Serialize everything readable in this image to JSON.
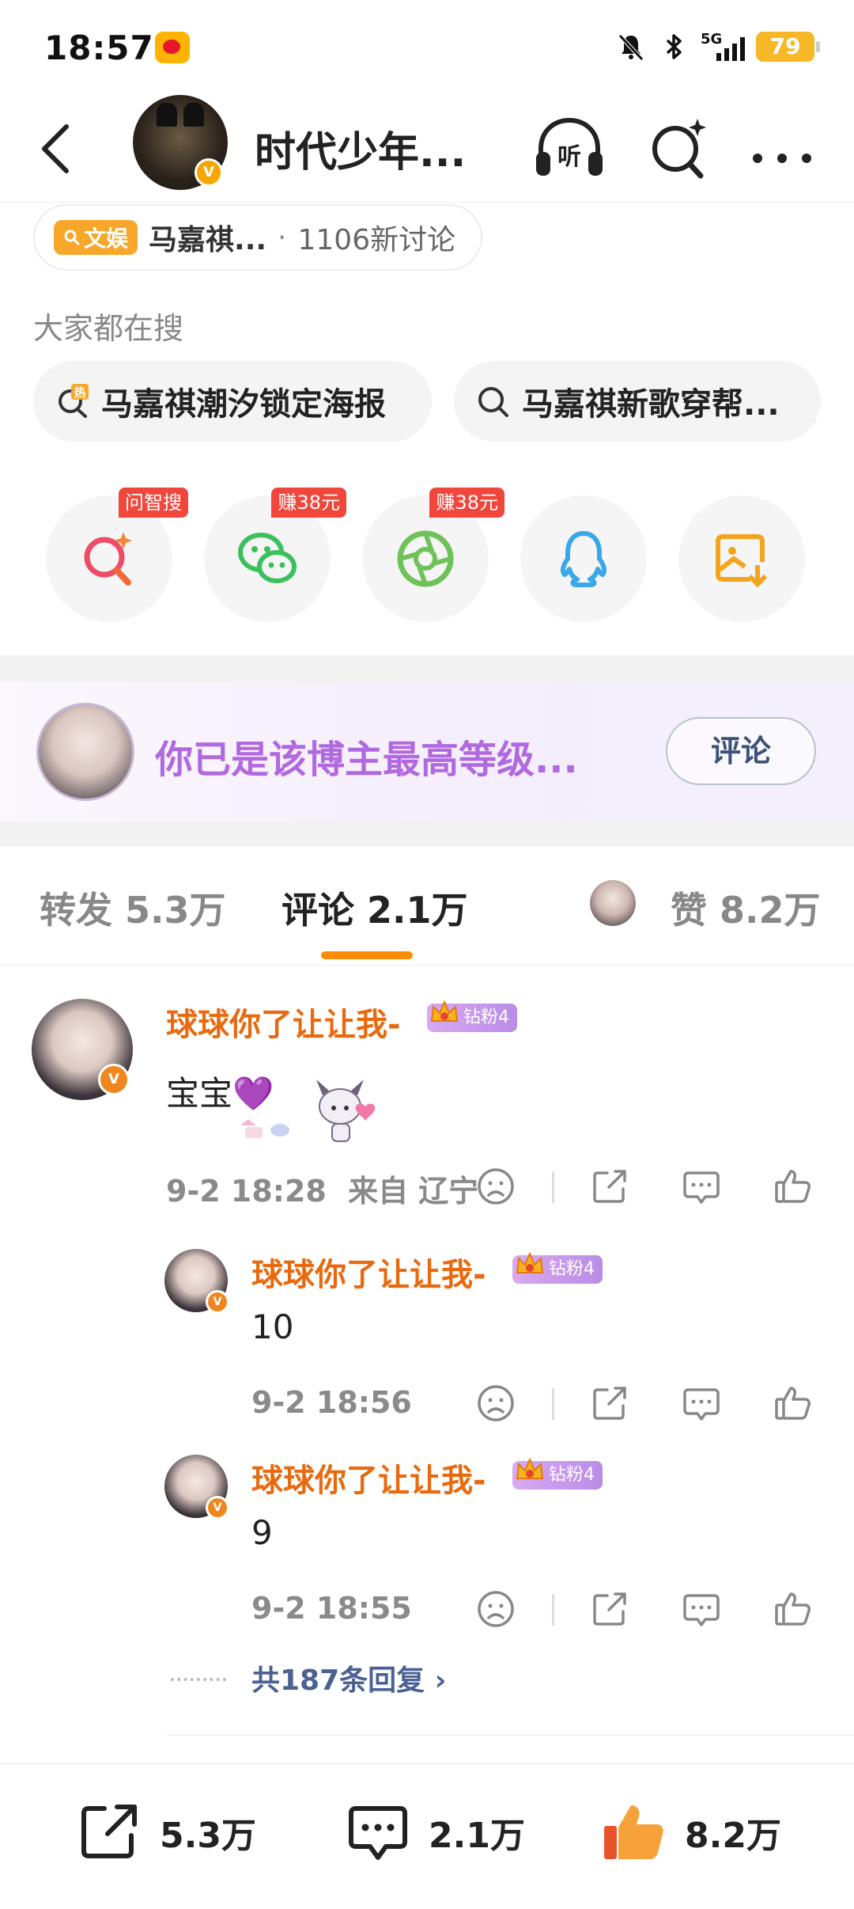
{
  "status_bar": {
    "time": "18:57",
    "network": "5G",
    "battery": "79"
  },
  "header": {
    "title": "时代少年..."
  },
  "topic": {
    "tag": "文娱",
    "name": "马嘉祺...",
    "separator": "·",
    "count": "1106新讨论"
  },
  "hot_search": {
    "label": "大家都在搜",
    "items": [
      {
        "text": "马嘉祺潮汐锁定海报",
        "badge": "热"
      },
      {
        "text": "马嘉祺新歌穿帮..."
      }
    ]
  },
  "share": {
    "items": [
      {
        "icon": "ai-search-icon",
        "badge": "问智搜"
      },
      {
        "icon": "wechat-icon",
        "badge": "赚38元"
      },
      {
        "icon": "moments-icon",
        "badge": "赚38元"
      },
      {
        "icon": "qq-icon"
      },
      {
        "icon": "save-image-icon"
      }
    ]
  },
  "fan_banner": {
    "text": "你已是该博主最高等级...",
    "button": "评论"
  },
  "tabs": {
    "repost": "转发 5.3万",
    "comment": "评论 2.1万",
    "like": "赞 8.2万"
  },
  "comments": [
    {
      "user": "球球你了让让我-",
      "fan_level": "钻粉4",
      "text": "宝宝💜",
      "time": "9-2 18:28",
      "location": "来自 辽宁",
      "replies": [
        {
          "user": "球球你了让让我-",
          "fan_level": "钻粉4",
          "text": "10",
          "time": "9-2 18:56"
        },
        {
          "user": "球球你了让让我-",
          "fan_level": "钻粉4",
          "text": "9",
          "time": "9-2 18:55"
        }
      ],
      "more_replies": "共187条回复 ›"
    }
  ],
  "bottom_bar": {
    "repost": "5.3万",
    "comment": "2.1万",
    "like": "8.2万"
  },
  "colors": {
    "accent": "#ff8c00",
    "username": "#e86a10",
    "fan_text": "#b169e0",
    "like_orange": "#f7a13a"
  }
}
